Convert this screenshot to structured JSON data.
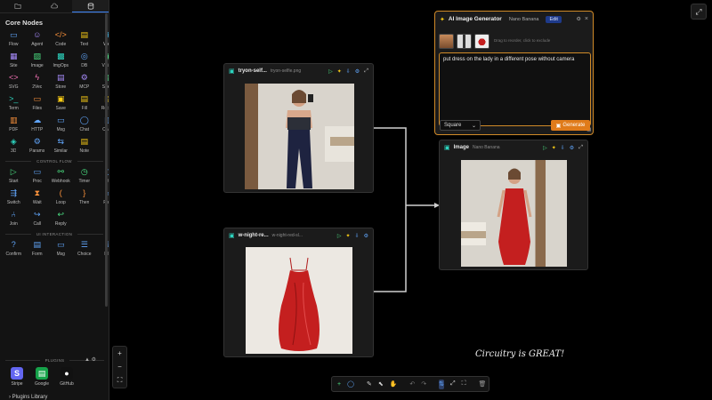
{
  "sidebar": {
    "tabs": [
      {
        "icon": "folder-icon"
      },
      {
        "icon": "cloud-icon"
      },
      {
        "icon": "database-icon"
      }
    ],
    "core_title": "Core Nodes",
    "core_nodes": [
      {
        "label": "Flow",
        "glyph": "▭",
        "color": "#60a5fa"
      },
      {
        "label": "Agent",
        "glyph": "☺",
        "color": "#a78bfa"
      },
      {
        "label": "Code",
        "glyph": "</>",
        "color": "#fb923c"
      },
      {
        "label": "Text",
        "glyph": "▤",
        "color": "#facc15"
      },
      {
        "label": "Web",
        "glyph": "⊕",
        "color": "#38bdf8"
      },
      {
        "label": "Site",
        "glyph": "▦",
        "color": "#a78bfa"
      },
      {
        "label": "Image",
        "glyph": "▨",
        "color": "#4ade80"
      },
      {
        "label": "ImgOps",
        "glyph": "▩",
        "color": "#2dd4bf"
      },
      {
        "label": "DB",
        "glyph": "◎",
        "color": "#60a5fa"
      },
      {
        "label": "Vision",
        "glyph": "◉",
        "color": "#4ade80"
      },
      {
        "label": "SVG",
        "glyph": "<>",
        "color": "#f472b6"
      },
      {
        "label": "2Vec",
        "glyph": "ϟ",
        "color": "#f472b6"
      },
      {
        "label": "Store",
        "glyph": "▤",
        "color": "#a78bfa"
      },
      {
        "label": "MCP",
        "glyph": "⚙",
        "color": "#a78bfa"
      },
      {
        "label": "Sheet",
        "glyph": "▦",
        "color": "#4ade80"
      },
      {
        "label": "Term",
        "glyph": ">_",
        "color": "#2dd4bf"
      },
      {
        "label": "Files",
        "glyph": "▭",
        "color": "#fb923c"
      },
      {
        "label": "Save",
        "glyph": "▣",
        "color": "#facc15"
      },
      {
        "label": "Fill",
        "glyph": "▤",
        "color": "#facc15"
      },
      {
        "label": "Report",
        "glyph": "▤",
        "color": "#facc15"
      },
      {
        "label": "PDF",
        "glyph": "▥",
        "color": "#fb923c"
      },
      {
        "label": "HTTP",
        "glyph": "☁",
        "color": "#60a5fa"
      },
      {
        "label": "Msg",
        "glyph": "▭",
        "color": "#60a5fa"
      },
      {
        "label": "Chat",
        "glyph": "◯",
        "color": "#60a5fa"
      },
      {
        "label": "Chart",
        "glyph": "▥",
        "color": "#60a5fa"
      },
      {
        "label": "3D",
        "glyph": "◈",
        "color": "#2dd4bf"
      },
      {
        "label": "Params",
        "glyph": "⚙",
        "color": "#60a5fa"
      },
      {
        "label": "Similar",
        "glyph": "⇆",
        "color": "#60a5fa"
      },
      {
        "label": "Note",
        "glyph": "▤",
        "color": "#facc15"
      }
    ],
    "control_flow_title": "CONTROL FLOW",
    "control_flow": [
      {
        "label": "Start",
        "glyph": "▷",
        "color": "#4ade80"
      },
      {
        "label": "Proc",
        "glyph": "▭",
        "color": "#60a5fa"
      },
      {
        "label": "Webhook",
        "glyph": "⚯",
        "color": "#4ade80"
      },
      {
        "label": "Timer",
        "glyph": "◷",
        "color": "#4ade80"
      },
      {
        "label": "If",
        "glyph": "◇",
        "color": "#60a5fa"
      },
      {
        "label": "Switch",
        "glyph": "⇶",
        "color": "#60a5fa"
      },
      {
        "label": "Wait",
        "glyph": "⧗",
        "color": "#fb923c"
      },
      {
        "label": "Loop",
        "glyph": "(",
        "color": "#fb923c"
      },
      {
        "label": "Then",
        "glyph": "}",
        "color": "#fb923c"
      },
      {
        "label": "Fork",
        "glyph": "⑂",
        "color": "#60a5fa"
      },
      {
        "label": "Join",
        "glyph": "⑃",
        "color": "#60a5fa"
      },
      {
        "label": "Call",
        "glyph": "↪",
        "color": "#60a5fa"
      },
      {
        "label": "Reply",
        "glyph": "↩",
        "color": "#4ade80"
      }
    ],
    "ui_title": "UI INTERACTION",
    "ui_nodes": [
      {
        "label": "Confirm",
        "glyph": "?",
        "color": "#60a5fa"
      },
      {
        "label": "Form",
        "glyph": "▤",
        "color": "#60a5fa"
      },
      {
        "label": "Msg",
        "glyph": "▭",
        "color": "#60a5fa"
      },
      {
        "label": "Choice",
        "glyph": "☰",
        "color": "#60a5fa"
      },
      {
        "label": "File",
        "glyph": "⇪",
        "color": "#60a5fa"
      }
    ],
    "plugins_title": "PLUGINS",
    "plugins": [
      {
        "label": "Stripe",
        "glyph": "S",
        "color": "#6366f1"
      },
      {
        "label": "Google",
        "glyph": "▤",
        "color": "#16a34a"
      },
      {
        "label": "GitHub",
        "glyph": "●",
        "color": "#111111"
      }
    ],
    "plugins_library": "Plugins Library"
  },
  "nodes": {
    "tryon": {
      "title": "tryon-self...",
      "file": "tryon-selfie.png"
    },
    "dress": {
      "title": "w-night-re...",
      "file": "w-night-red-sl..."
    },
    "output": {
      "title": "Image",
      "model": "Nano Banana"
    }
  },
  "ai_node": {
    "title": "AI Image Generator",
    "model": "Nano Banana",
    "mode": "Edit",
    "thumb_hint": "Drag to reorder, click to exclude",
    "prompt": "put dress on the lady in a different pose without camera",
    "aspect": "Square",
    "generate_label": "Generate"
  },
  "toolbar": {
    "tools": [
      "add-icon",
      "chat-icon",
      "pen-icon",
      "select-icon",
      "hand-icon",
      "undo-icon",
      "redo-icon",
      "layout-icon",
      "fit-icon",
      "expand-icon",
      "trash-icon"
    ]
  },
  "caption": "Circuitry is GREAT!",
  "colors": {
    "accent": "#e07b1a",
    "link": "#60a5fa",
    "node_bg": "#1b1b1b"
  }
}
